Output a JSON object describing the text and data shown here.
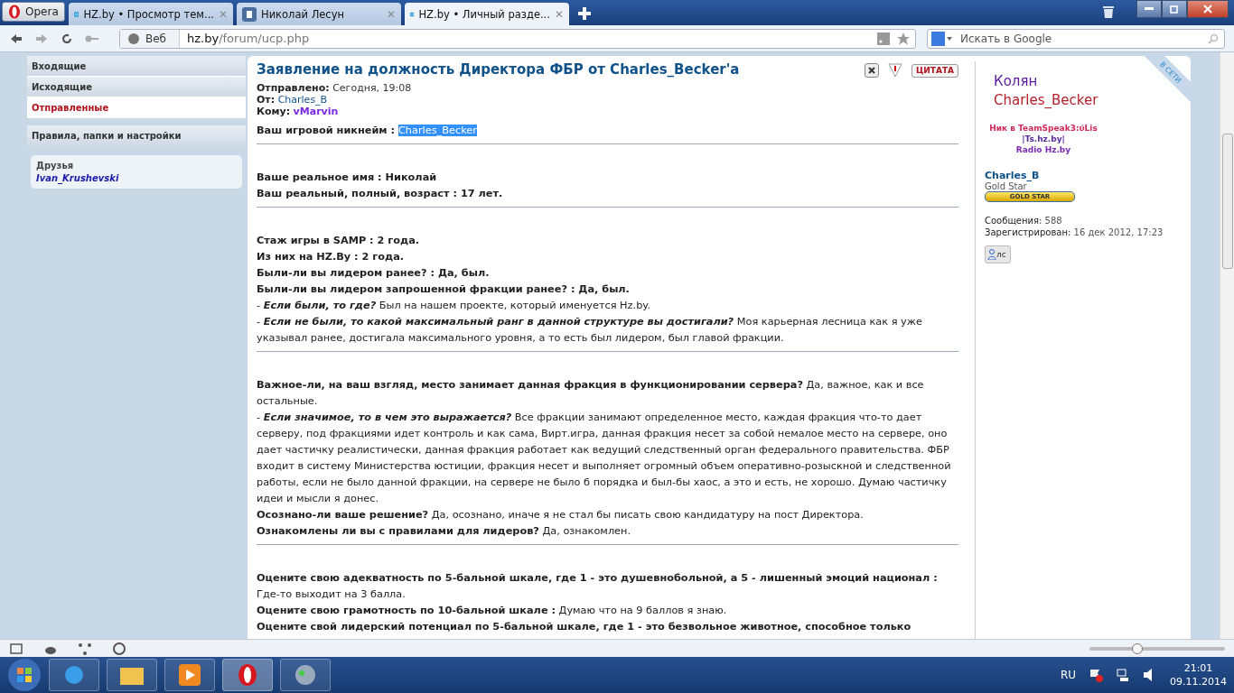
{
  "browser": {
    "menu_button": "Opera",
    "tabs": [
      {
        "title": "HZ.by • Просмотр тем...",
        "kind": "site",
        "close": "✕",
        "selected": false
      },
      {
        "title": "Николай Лесун",
        "kind": "vk",
        "close": "✕",
        "selected": false
      },
      {
        "title": "HZ.by • Личный разде...",
        "kind": "site",
        "close": "✕",
        "selected": true
      }
    ],
    "address": {
      "scope": "Веб",
      "domain": "hz.by",
      "path": "/forum/ucp.php"
    },
    "search": {
      "placeholder": "Искать в Google"
    }
  },
  "sidebar": {
    "items": [
      {
        "label": "Входящие",
        "selected": false
      },
      {
        "label": "Исходящие",
        "selected": false
      },
      {
        "label": "Отправленные",
        "selected": true
      }
    ],
    "settings": "Правила, папки и настройки",
    "friends": {
      "title": "Друзья",
      "names": [
        "Ivan_Krushevski"
      ]
    }
  },
  "message": {
    "title": "Заявление на должность Директора ФБР от Charles_Becker'a",
    "quote_button": "ЦИТАТА",
    "meta": [
      {
        "label": "Отправлено:",
        "value": "Сегодня, 19:08",
        "kind": "plain"
      },
      {
        "label": "От:",
        "value": "Charles_B",
        "kind": "link"
      },
      {
        "label": "Кому:",
        "value": "vMarvin",
        "kind": "user"
      }
    ],
    "sections": [
      [
        {
          "text": "Ваш игровой никнейм : ",
          "highlight": "Charles_Becker",
          "kind": "heading"
        }
      ],
      [
        {
          "text": "Ваше реальное имя : Николай",
          "kind": "heading"
        },
        {
          "text": "Ваш реальный, полный, возраст : 17 лет.",
          "kind": "heading"
        }
      ],
      [
        {
          "text": "Стаж игры в SAMP : 2 года.",
          "kind": "heading"
        },
        {
          "text": "Из них на HZ.By : 2 года.",
          "kind": "heading"
        },
        {
          "text": "Были-ли вы лидером ранее? : Да, был.",
          "kind": "heading"
        },
        {
          "text": "Были-ли вы лидером запрошенной фракции ранее? : Да, был.",
          "kind": "heading"
        },
        {
          "lead": "-",
          "question": "Если были, то где?",
          "text": "Был на нашем проекте, который именуется Hz.by.",
          "kind": "sub"
        },
        {
          "lead": "-",
          "question": "Если не были, то какой максимальный ранг в данной структуре вы достигали?",
          "text": "Моя карьерная лесница как я уже указывал ранее, достигала максимального уровня, а то есть был лидером, был главой фракции.",
          "kind": "sub"
        }
      ],
      [
        {
          "text": "**Важное-ли, на ваш взгляд, место занимает данная фракция в функционировании сервера?** Да, важное, как и все остальные.",
          "kind": "answer"
        },
        {
          "lead": "-",
          "question": "Если значимое, то в чем это выражается?",
          "kind": "sub",
          "text": "Все фракции занимают определенное место, каждая фракция что-то дает серверу, под фракциями идет контроль и как сама, Вирт.игра, данная фракция несет за собой немалое место на сервере, оно дает частичку реалистически, данная фракция работает как ведущий следственный орган федерального правительства. ФБР входит в систему Министерства юстиции, фракция несет и выполняет огромный объем оперативно-розыскной и следственной работы, если не было данной фракции, на сервере не было б порядка и был-бы хаос, а это и есть, не хорошо. Думаю частичку идеи и мысли я донес."
        },
        {
          "text": "**Осознано-ли ваше решение?** Да, осознано, иначе я не стал бы писать свою кандидатуру на пост Директора.",
          "kind": "answer"
        },
        {
          "text": "**Ознакомлены ли вы с правилами для лидеров?** Да, ознакомлен.",
          "kind": "answer"
        }
      ],
      [
        {
          "text": "**Оцените свою адекватность по 5-бальной шкале, где 1 - это душевнобольной, а 5 - лишенный эмоций национал :** Где-то выходит на 3 балла.",
          "kind": "answer"
        },
        {
          "text": "**Оцените свою грамотность по 10-бальной шкале :** Думаю что на 9 баллов я знаю.",
          "kind": "answer"
        },
        {
          "text": "Оцените свой лидерский потенциал по 5-бальной шкале, где 1 - это безвольное животное, способное только",
          "kind": "heading"
        }
      ]
    ]
  },
  "profile": {
    "status": "В СЕТИ",
    "signature": [
      "Колян",
      "Charles_Becker"
    ],
    "signature_small": [
      "Ник в TeamSpeak3:ύLis",
      "|Ts.hz.by|",
      "Radio Hz.by"
    ],
    "username": "Charles_B",
    "rank": "Gold Star",
    "rank_badge": "GOLD STAR",
    "stats": [
      {
        "label": "Сообщения:",
        "value": "588"
      },
      {
        "label": "Зарегистрирован:",
        "value": "16 дек 2012, 17:23"
      }
    ],
    "pm_button": "лс"
  },
  "zoom": {
    "level": 0.35
  },
  "taskbar": {
    "language": "RU",
    "time": "21:01",
    "date": "09.11.2014"
  }
}
